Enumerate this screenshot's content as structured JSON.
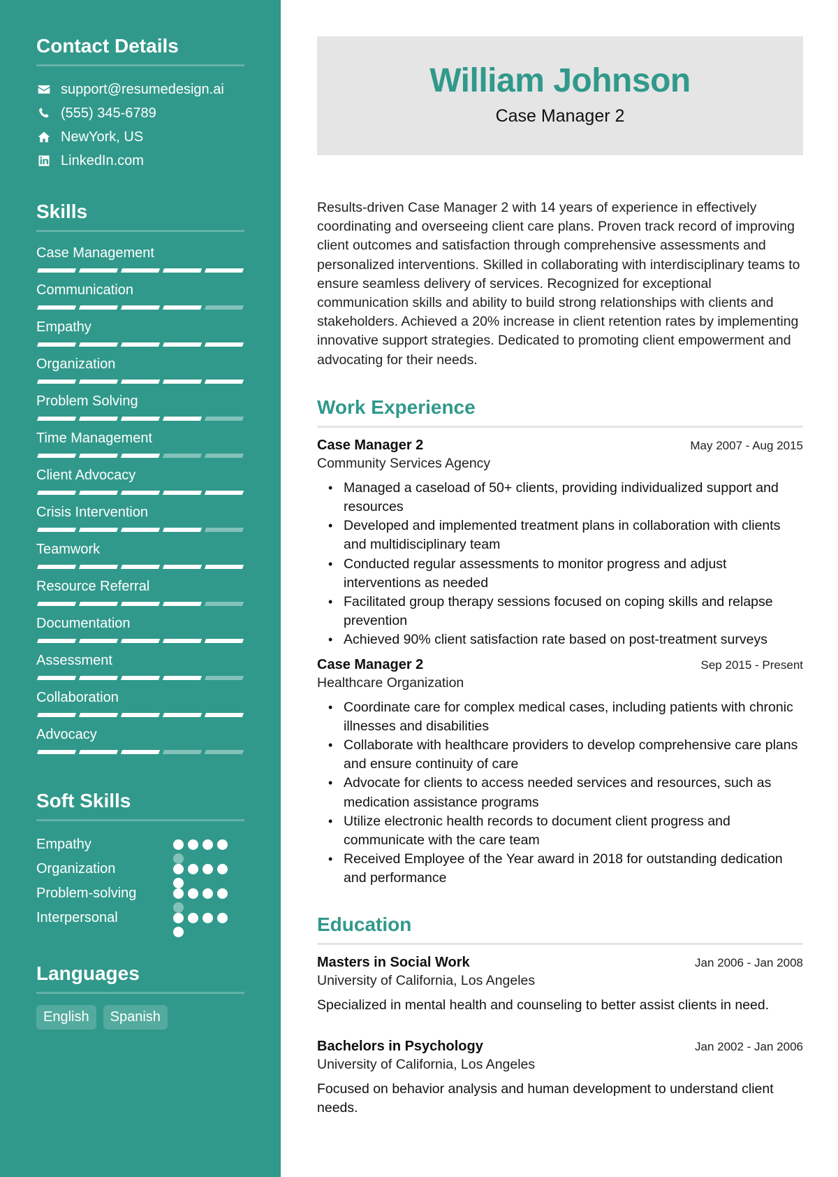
{
  "sidebar": {
    "contact": {
      "title": "Contact Details",
      "items": [
        {
          "icon": "envelope-icon",
          "text": "support@resumedesign.ai"
        },
        {
          "icon": "phone-icon",
          "text": "(555) 345-6789"
        },
        {
          "icon": "home-icon",
          "text": "NewYork, US"
        },
        {
          "icon": "linkedin-icon",
          "text": "LinkedIn.com"
        }
      ]
    },
    "skills": {
      "title": "Skills",
      "max": 5,
      "items": [
        {
          "name": "Case Management",
          "level": 5
        },
        {
          "name": "Communication",
          "level": 4
        },
        {
          "name": "Empathy",
          "level": 5
        },
        {
          "name": "Organization",
          "level": 5
        },
        {
          "name": "Problem Solving",
          "level": 4
        },
        {
          "name": "Time Management",
          "level": 3
        },
        {
          "name": "Client Advocacy",
          "level": 5
        },
        {
          "name": "Crisis Intervention",
          "level": 4
        },
        {
          "name": "Teamwork",
          "level": 5
        },
        {
          "name": "Resource Referral",
          "level": 4
        },
        {
          "name": "Documentation",
          "level": 5
        },
        {
          "name": "Assessment",
          "level": 4
        },
        {
          "name": "Collaboration",
          "level": 5
        },
        {
          "name": "Advocacy",
          "level": 3
        }
      ]
    },
    "soft_skills": {
      "title": "Soft Skills",
      "max": 5,
      "items": [
        {
          "name": "Empathy",
          "level": 4
        },
        {
          "name": "Organization",
          "level": 5
        },
        {
          "name": "Problem-solving",
          "level": 4
        },
        {
          "name": "Interpersonal",
          "level": 5
        }
      ]
    },
    "languages": {
      "title": "Languages",
      "items": [
        "English",
        "Spanish"
      ]
    }
  },
  "header": {
    "name": "William Johnson",
    "role": "Case Manager 2"
  },
  "summary": "Results-driven Case Manager 2 with 14 years of experience in effectively coordinating and overseeing client care plans. Proven track record of improving client outcomes and satisfaction through comprehensive assessments and personalized interventions. Skilled in collaborating with interdisciplinary teams to ensure seamless delivery of services. Recognized for exceptional communication skills and ability to build strong relationships with clients and stakeholders. Achieved a 20% increase in client retention rates by implementing innovative support strategies. Dedicated to promoting client empowerment and advocating for their needs.",
  "work": {
    "title": "Work Experience",
    "jobs": [
      {
        "title": "Case Manager 2",
        "dates": "May 2007 - Aug 2015",
        "org": "Community Services Agency",
        "bullets": [
          "Managed a caseload of 50+ clients, providing individualized support and resources",
          "Developed and implemented treatment plans in collaboration with clients and multidisciplinary team",
          "Conducted regular assessments to monitor progress and adjust interventions as needed",
          "Facilitated group therapy sessions focused on coping skills and relapse prevention",
          "Achieved 90% client satisfaction rate based on post-treatment surveys"
        ]
      },
      {
        "title": "Case Manager 2",
        "dates": "Sep 2015 - Present",
        "org": "Healthcare Organization",
        "bullets": [
          "Coordinate care for complex medical cases, including patients with chronic illnesses and disabilities",
          "Collaborate with healthcare providers to develop comprehensive care plans and ensure continuity of care",
          "Advocate for clients to access needed services and resources, such as medication assistance programs",
          "Utilize electronic health records to document client progress and communicate with the care team",
          "Received Employee of the Year award in 2018 for outstanding dedication and performance"
        ]
      }
    ]
  },
  "education": {
    "title": "Education",
    "items": [
      {
        "degree": "Masters in Social Work",
        "dates": "Jan 2006 - Jan 2008",
        "school": "University of California, Los Angeles",
        "desc": "Specialized in mental health and counseling to better assist clients in need."
      },
      {
        "degree": "Bachelors in Psychology",
        "dates": "Jan 2002 - Jan 2006",
        "school": "University of California, Los Angeles",
        "desc": "Focused on behavior analysis and human development to understand client needs."
      }
    ]
  },
  "colors": {
    "accent": "#31998b",
    "header_bg": "#e5e5e5"
  }
}
